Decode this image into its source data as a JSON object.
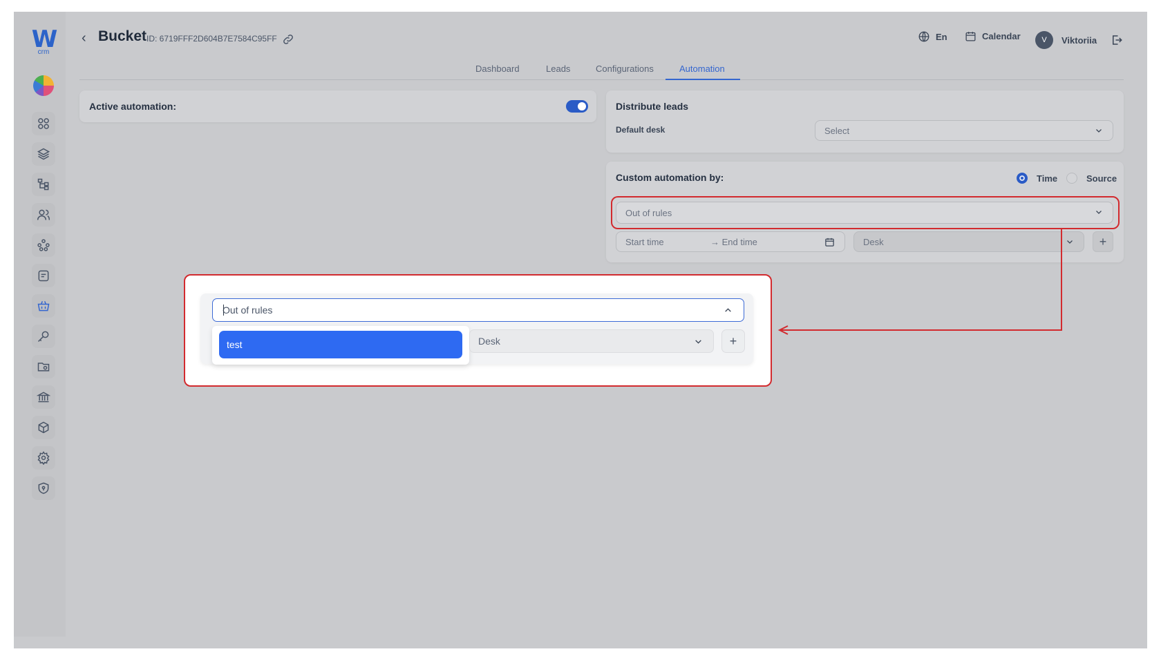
{
  "app": {
    "logo_text": "W",
    "logo_sub": "crm"
  },
  "header": {
    "back_label": "‹",
    "title": "Bucket",
    "id_text": "ID: 6719FFF2D604B7E7584C95FF",
    "language": "En",
    "calendar": "Calendar",
    "user_initial": "V",
    "user_name": "Viktoriia"
  },
  "tabs": [
    {
      "label": "Dashboard"
    },
    {
      "label": "Leads"
    },
    {
      "label": "Configurations"
    },
    {
      "label": "Automation",
      "active": true
    }
  ],
  "active_automation": {
    "label": "Active automation:",
    "enabled": true
  },
  "distribute": {
    "title": "Distribute leads",
    "default_desk_label": "Default desk",
    "default_desk_placeholder": "Select"
  },
  "custom": {
    "title": "Custom automation by:",
    "options": [
      {
        "label": "Time",
        "selected": true
      },
      {
        "label": "Source",
        "selected": false
      }
    ],
    "rule_select_value": "Out of rules",
    "start_time_placeholder": "Start time",
    "end_time_placeholder": "→ End time",
    "desk_placeholder": "Desk",
    "add_label": "+"
  },
  "zoom": {
    "input_value": "Out of rules",
    "option_selected": "test",
    "desk_placeholder": "Desk",
    "add_label": "+"
  },
  "colors": {
    "accent": "#2e6af2",
    "highlight": "#d22a2e"
  },
  "sidebar_icons": [
    "chart-pie-icon",
    "dashboard-icon",
    "layers-icon",
    "hierarchy-icon",
    "users-icon",
    "network-icon",
    "tasks-icon",
    "basket-icon",
    "key-icon",
    "folder-icon",
    "bank-icon",
    "box-icon",
    "settings-icon",
    "shield-icon"
  ]
}
